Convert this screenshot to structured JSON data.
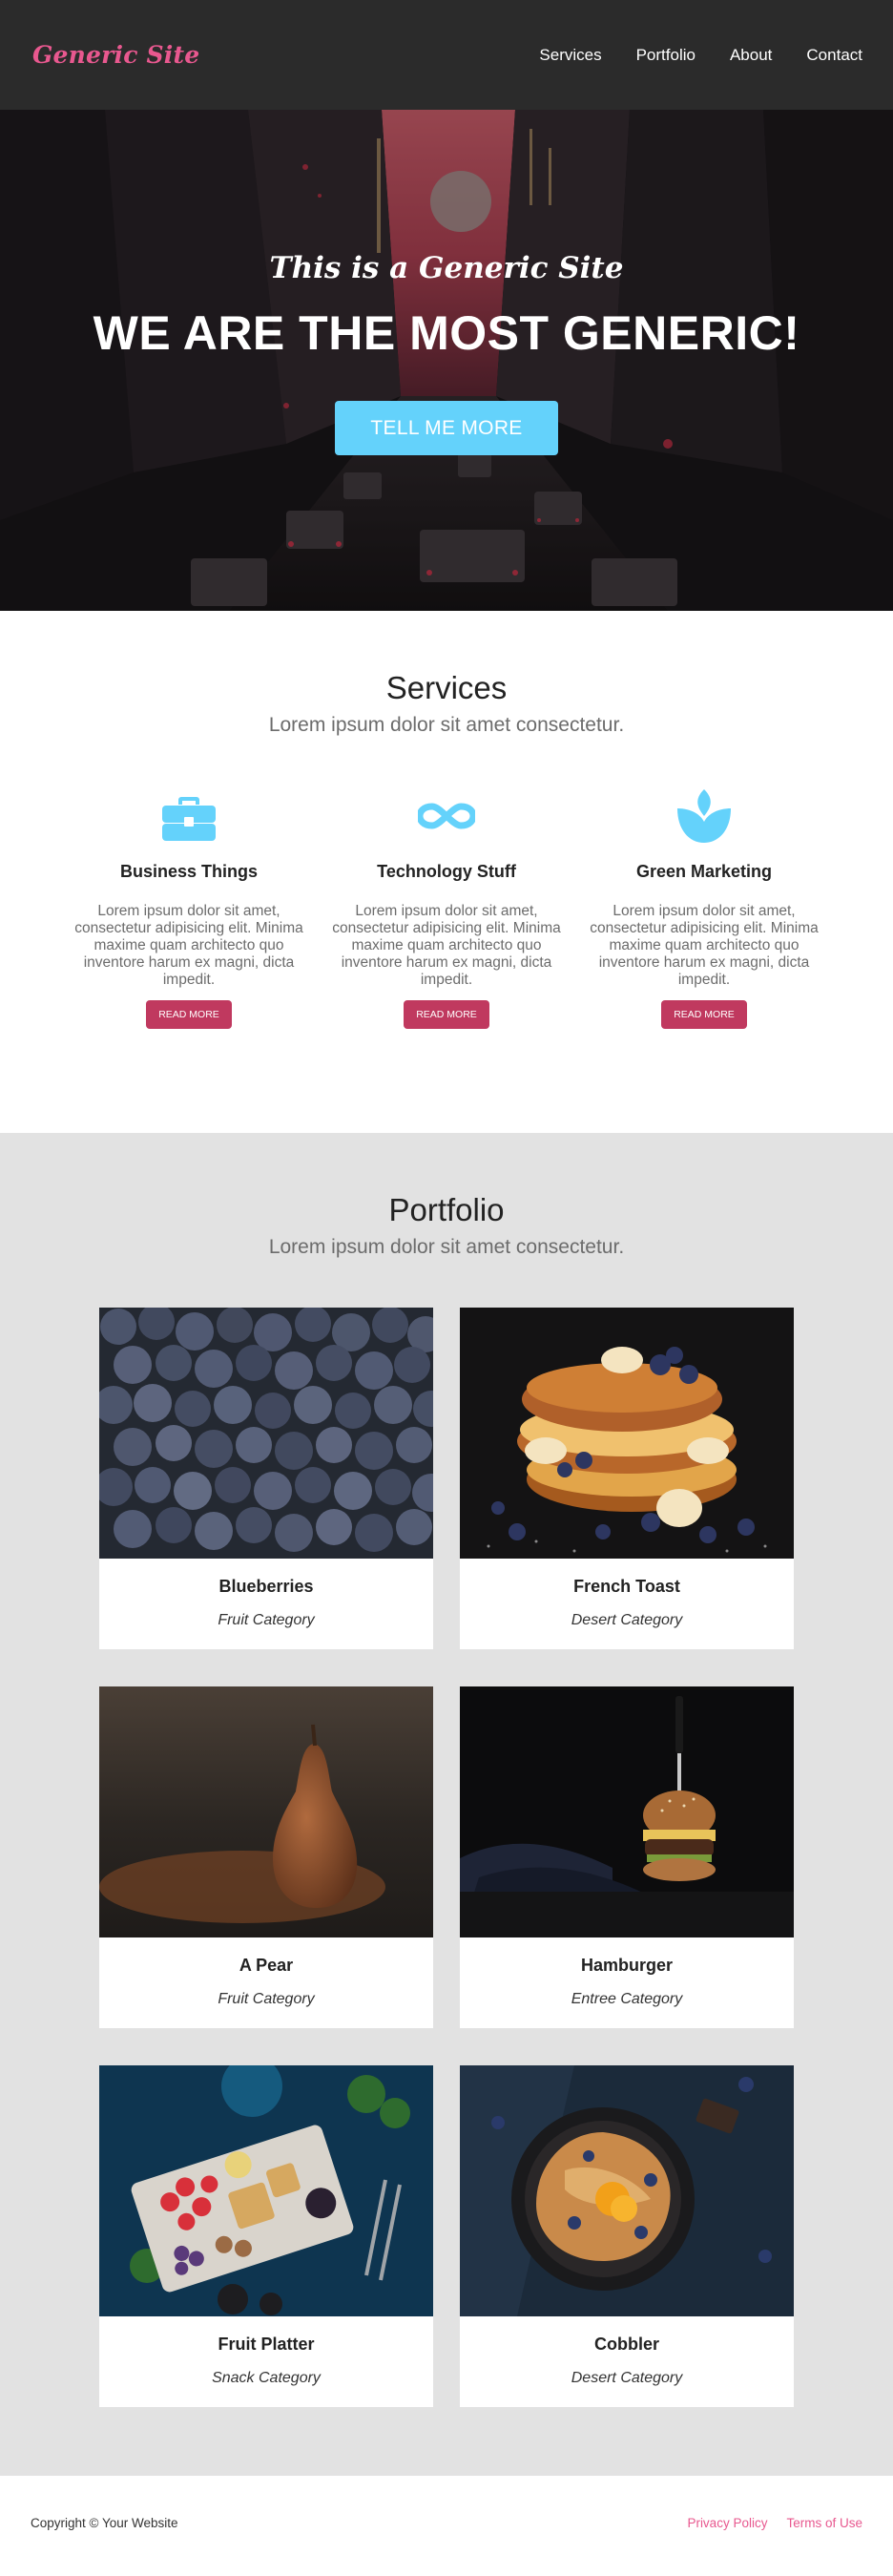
{
  "nav": {
    "brand": "Generic Site",
    "links": [
      "Services",
      "Portfolio",
      "About",
      "Contact"
    ]
  },
  "hero": {
    "subtitle": "This is a Generic Site",
    "title": "WE ARE THE MOST GENERIC!",
    "button": "TELL ME MORE"
  },
  "services": {
    "title": "Services",
    "subtitle": "Lorem ipsum dolor sit amet consectetur.",
    "items": [
      {
        "icon": "briefcase-icon",
        "title": "Business Things",
        "description": "Lorem ipsum dolor sit amet, consectetur adipisicing elit. Minima maxime quam architecto quo inventore harum ex magni, dicta impedit.",
        "button": "READ MORE"
      },
      {
        "icon": "infinity-icon",
        "title": "Technology Stuff",
        "description": "Lorem ipsum dolor sit amet, consectetur adipisicing elit. Minima maxime quam architecto quo inventore harum ex magni, dicta impedit.",
        "button": "READ MORE"
      },
      {
        "icon": "leaf-icon",
        "title": "Green Marketing",
        "description": "Lorem ipsum dolor sit amet, consectetur adipisicing elit. Minima maxime quam architecto quo inventore harum ex magni, dicta impedit.",
        "button": "READ MORE"
      }
    ]
  },
  "portfolio": {
    "title": "Portfolio",
    "subtitle": "Lorem ipsum dolor sit amet consectetur.",
    "items": [
      {
        "title": "Blueberries",
        "category": "Fruit Category"
      },
      {
        "title": "French Toast",
        "category": "Desert Category"
      },
      {
        "title": "A Pear",
        "category": "Fruit Category"
      },
      {
        "title": "Hamburger",
        "category": "Entree Category"
      },
      {
        "title": "Fruit Platter",
        "category": "Snack Category"
      },
      {
        "title": "Cobbler",
        "category": "Desert Category"
      }
    ]
  },
  "footer": {
    "copyright": "Copyright © Your Website",
    "links": [
      "Privacy Policy",
      "Terms of Use"
    ]
  },
  "colors": {
    "brand_pink": "#e8588f",
    "accent_blue": "#64d2fb",
    "button_red": "#c0395f",
    "nav_bg": "#2b2b2b",
    "portfolio_bg": "#e2e2e2"
  }
}
